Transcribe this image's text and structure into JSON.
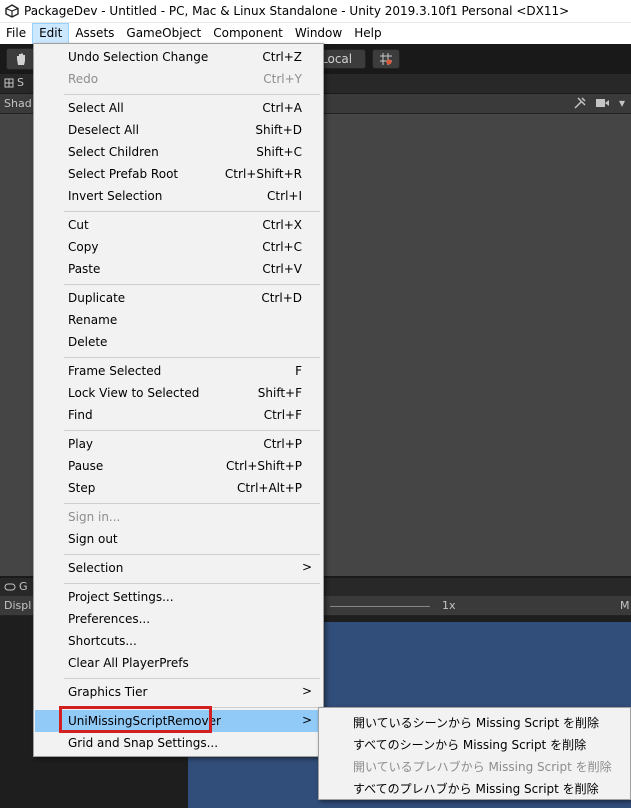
{
  "window": {
    "title": "PackageDev - Untitled - PC, Mac & Linux Standalone - Unity 2019.3.10f1 Personal <DX11>"
  },
  "menubar": {
    "items": [
      "File",
      "Edit",
      "Assets",
      "GameObject",
      "Component",
      "Window",
      "Help"
    ]
  },
  "toolbar": {
    "pivot_space_label": "Local"
  },
  "scene": {
    "tab_label": "S",
    "shading_mode": "Shad"
  },
  "game": {
    "tab_label": "G",
    "display_label": "Displ",
    "scale_label": "1x",
    "maximize_label": "M"
  },
  "edit_menu": {
    "items": [
      {
        "label": "Undo Selection Change",
        "shortcut": "Ctrl+Z"
      },
      {
        "label": "Redo",
        "shortcut": "Ctrl+Y"
      },
      {
        "label": "Select All",
        "shortcut": "Ctrl+A"
      },
      {
        "label": "Deselect All",
        "shortcut": "Shift+D"
      },
      {
        "label": "Select Children",
        "shortcut": "Shift+C"
      },
      {
        "label": "Select Prefab Root",
        "shortcut": "Ctrl+Shift+R"
      },
      {
        "label": "Invert Selection",
        "shortcut": "Ctrl+I"
      },
      {
        "label": "Cut",
        "shortcut": "Ctrl+X"
      },
      {
        "label": "Copy",
        "shortcut": "Ctrl+C"
      },
      {
        "label": "Paste",
        "shortcut": "Ctrl+V"
      },
      {
        "label": "Duplicate",
        "shortcut": "Ctrl+D"
      },
      {
        "label": "Rename",
        "shortcut": ""
      },
      {
        "label": "Delete",
        "shortcut": ""
      },
      {
        "label": "Frame Selected",
        "shortcut": "F"
      },
      {
        "label": "Lock View to Selected",
        "shortcut": "Shift+F"
      },
      {
        "label": "Find",
        "shortcut": "Ctrl+F"
      },
      {
        "label": "Play",
        "shortcut": "Ctrl+P"
      },
      {
        "label": "Pause",
        "shortcut": "Ctrl+Shift+P"
      },
      {
        "label": "Step",
        "shortcut": "Ctrl+Alt+P"
      },
      {
        "label": "Sign in...",
        "shortcut": ""
      },
      {
        "label": "Sign out",
        "shortcut": ""
      },
      {
        "label": "Selection",
        "shortcut": ""
      },
      {
        "label": "Project Settings...",
        "shortcut": ""
      },
      {
        "label": "Preferences...",
        "shortcut": ""
      },
      {
        "label": "Shortcuts...",
        "shortcut": ""
      },
      {
        "label": "Clear All PlayerPrefs",
        "shortcut": ""
      },
      {
        "label": "Graphics Tier",
        "shortcut": ""
      },
      {
        "label": "UniMissingScriptRemover",
        "shortcut": ""
      },
      {
        "label": "Grid and Snap Settings...",
        "shortcut": ""
      }
    ],
    "submenu_arrow": ">"
  },
  "submenu": {
    "items": [
      {
        "label": "開いているシーンから Missing Script を削除"
      },
      {
        "label": "すべてのシーンから Missing Script を削除"
      },
      {
        "label": "開いているプレハブから Missing Script を削除"
      },
      {
        "label": "すべてのプレハブから Missing Script を削除"
      }
    ]
  },
  "colors": {
    "menu_highlight": "#91c9f7",
    "red_annotation": "#d21f1f",
    "game_canvas": "#314d79"
  }
}
